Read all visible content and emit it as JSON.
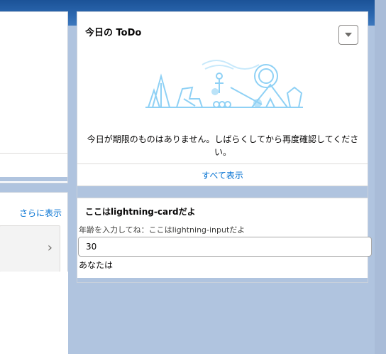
{
  "todo_card": {
    "title": "今日の ToDo",
    "empty_message": "今日が期限のものはありません。しばらくしてから再度確認してください。",
    "view_all": "すべて表示",
    "menu_icon": "chevron-down-icon"
  },
  "left_panel": {
    "more_link": "さらに表示",
    "row_icon": "chevron-right-icon"
  },
  "lightning_card": {
    "title": "ここはlightning-cardだよ",
    "input_label": "年齢を入力してね：ここはlightning-inputだよ",
    "input_value": "30",
    "result_text": "あなたは"
  },
  "colors": {
    "background": "#b0c4df",
    "header": "#1b5297",
    "link": "#0070d2",
    "illustration": "#8fd1f5"
  }
}
